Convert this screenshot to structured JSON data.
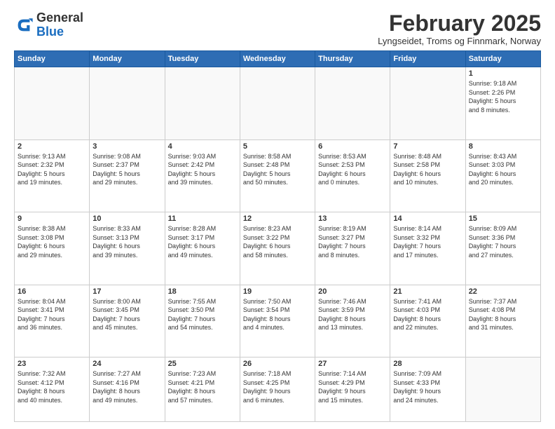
{
  "header": {
    "logo_general": "General",
    "logo_blue": "Blue",
    "month_title": "February 2025",
    "subtitle": "Lyngseidet, Troms og Finnmark, Norway"
  },
  "weekdays": [
    "Sunday",
    "Monday",
    "Tuesday",
    "Wednesday",
    "Thursday",
    "Friday",
    "Saturday"
  ],
  "weeks": [
    [
      {
        "day": "",
        "info": ""
      },
      {
        "day": "",
        "info": ""
      },
      {
        "day": "",
        "info": ""
      },
      {
        "day": "",
        "info": ""
      },
      {
        "day": "",
        "info": ""
      },
      {
        "day": "",
        "info": ""
      },
      {
        "day": "1",
        "info": "Sunrise: 9:18 AM\nSunset: 2:26 PM\nDaylight: 5 hours\nand 8 minutes."
      }
    ],
    [
      {
        "day": "2",
        "info": "Sunrise: 9:13 AM\nSunset: 2:32 PM\nDaylight: 5 hours\nand 19 minutes."
      },
      {
        "day": "3",
        "info": "Sunrise: 9:08 AM\nSunset: 2:37 PM\nDaylight: 5 hours\nand 29 minutes."
      },
      {
        "day": "4",
        "info": "Sunrise: 9:03 AM\nSunset: 2:42 PM\nDaylight: 5 hours\nand 39 minutes."
      },
      {
        "day": "5",
        "info": "Sunrise: 8:58 AM\nSunset: 2:48 PM\nDaylight: 5 hours\nand 50 minutes."
      },
      {
        "day": "6",
        "info": "Sunrise: 8:53 AM\nSunset: 2:53 PM\nDaylight: 6 hours\nand 0 minutes."
      },
      {
        "day": "7",
        "info": "Sunrise: 8:48 AM\nSunset: 2:58 PM\nDaylight: 6 hours\nand 10 minutes."
      },
      {
        "day": "8",
        "info": "Sunrise: 8:43 AM\nSunset: 3:03 PM\nDaylight: 6 hours\nand 20 minutes."
      }
    ],
    [
      {
        "day": "9",
        "info": "Sunrise: 8:38 AM\nSunset: 3:08 PM\nDaylight: 6 hours\nand 29 minutes."
      },
      {
        "day": "10",
        "info": "Sunrise: 8:33 AM\nSunset: 3:13 PM\nDaylight: 6 hours\nand 39 minutes."
      },
      {
        "day": "11",
        "info": "Sunrise: 8:28 AM\nSunset: 3:17 PM\nDaylight: 6 hours\nand 49 minutes."
      },
      {
        "day": "12",
        "info": "Sunrise: 8:23 AM\nSunset: 3:22 PM\nDaylight: 6 hours\nand 58 minutes."
      },
      {
        "day": "13",
        "info": "Sunrise: 8:19 AM\nSunset: 3:27 PM\nDaylight: 7 hours\nand 8 minutes."
      },
      {
        "day": "14",
        "info": "Sunrise: 8:14 AM\nSunset: 3:32 PM\nDaylight: 7 hours\nand 17 minutes."
      },
      {
        "day": "15",
        "info": "Sunrise: 8:09 AM\nSunset: 3:36 PM\nDaylight: 7 hours\nand 27 minutes."
      }
    ],
    [
      {
        "day": "16",
        "info": "Sunrise: 8:04 AM\nSunset: 3:41 PM\nDaylight: 7 hours\nand 36 minutes."
      },
      {
        "day": "17",
        "info": "Sunrise: 8:00 AM\nSunset: 3:45 PM\nDaylight: 7 hours\nand 45 minutes."
      },
      {
        "day": "18",
        "info": "Sunrise: 7:55 AM\nSunset: 3:50 PM\nDaylight: 7 hours\nand 54 minutes."
      },
      {
        "day": "19",
        "info": "Sunrise: 7:50 AM\nSunset: 3:54 PM\nDaylight: 8 hours\nand 4 minutes."
      },
      {
        "day": "20",
        "info": "Sunrise: 7:46 AM\nSunset: 3:59 PM\nDaylight: 8 hours\nand 13 minutes."
      },
      {
        "day": "21",
        "info": "Sunrise: 7:41 AM\nSunset: 4:03 PM\nDaylight: 8 hours\nand 22 minutes."
      },
      {
        "day": "22",
        "info": "Sunrise: 7:37 AM\nSunset: 4:08 PM\nDaylight: 8 hours\nand 31 minutes."
      }
    ],
    [
      {
        "day": "23",
        "info": "Sunrise: 7:32 AM\nSunset: 4:12 PM\nDaylight: 8 hours\nand 40 minutes."
      },
      {
        "day": "24",
        "info": "Sunrise: 7:27 AM\nSunset: 4:16 PM\nDaylight: 8 hours\nand 49 minutes."
      },
      {
        "day": "25",
        "info": "Sunrise: 7:23 AM\nSunset: 4:21 PM\nDaylight: 8 hours\nand 57 minutes."
      },
      {
        "day": "26",
        "info": "Sunrise: 7:18 AM\nSunset: 4:25 PM\nDaylight: 9 hours\nand 6 minutes."
      },
      {
        "day": "27",
        "info": "Sunrise: 7:14 AM\nSunset: 4:29 PM\nDaylight: 9 hours\nand 15 minutes."
      },
      {
        "day": "28",
        "info": "Sunrise: 7:09 AM\nSunset: 4:33 PM\nDaylight: 9 hours\nand 24 minutes."
      },
      {
        "day": "",
        "info": ""
      }
    ]
  ]
}
